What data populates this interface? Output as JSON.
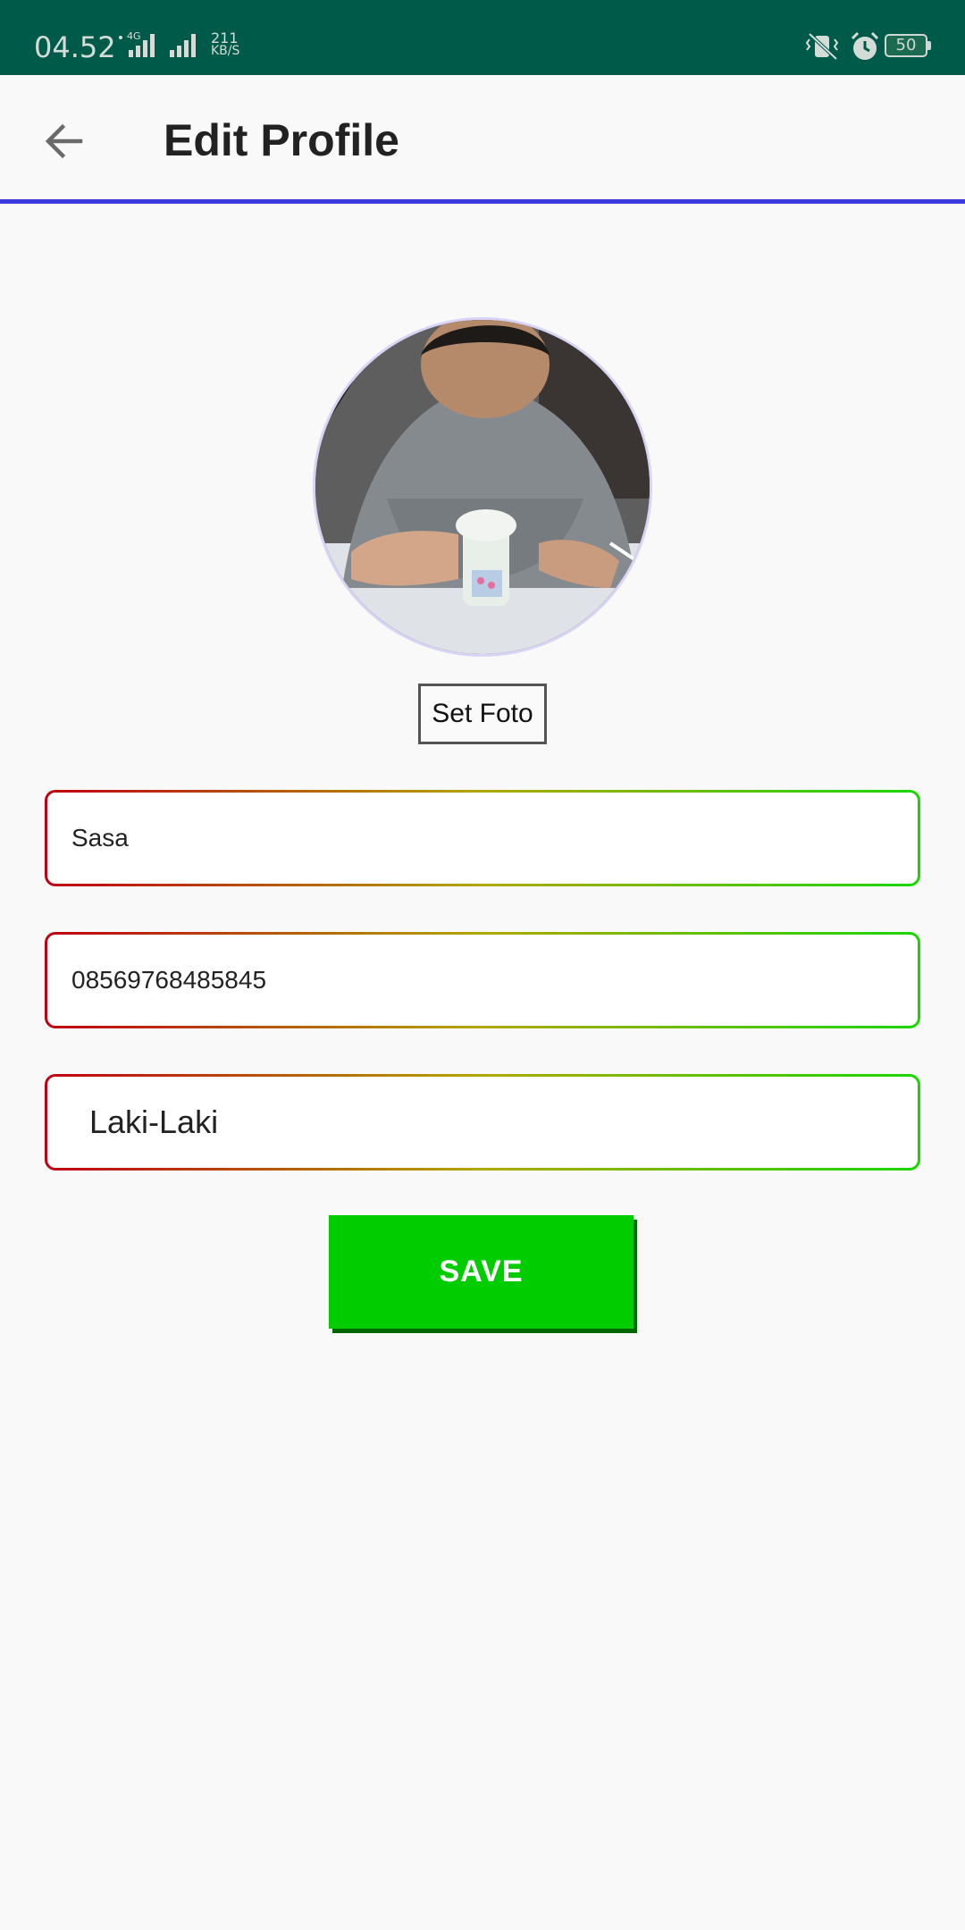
{
  "status_bar": {
    "time": "04.52",
    "network_type": "4G",
    "net_speed_value": "211",
    "net_speed_unit": "KB/S",
    "battery_level": "50",
    "icons": [
      "signal-icon",
      "signal-icon",
      "vibrate-icon",
      "alarm-icon",
      "battery-icon"
    ]
  },
  "app_bar": {
    "title": "Edit Profile",
    "back_icon": "arrow-back-icon",
    "accent_color": "#3a3adf"
  },
  "profile": {
    "set_photo_label": "Set Foto"
  },
  "form": {
    "name_value": "Sasa",
    "phone_value": "08569768485845",
    "gender_value": "Laki-Laki",
    "border_gradient": [
      "#c00015",
      "#b0a800",
      "#19d600"
    ]
  },
  "actions": {
    "save_label": "SAVE",
    "save_color": "#00cc00"
  },
  "colors": {
    "status_bar": "#005a4a",
    "background": "#f9f9f9"
  }
}
